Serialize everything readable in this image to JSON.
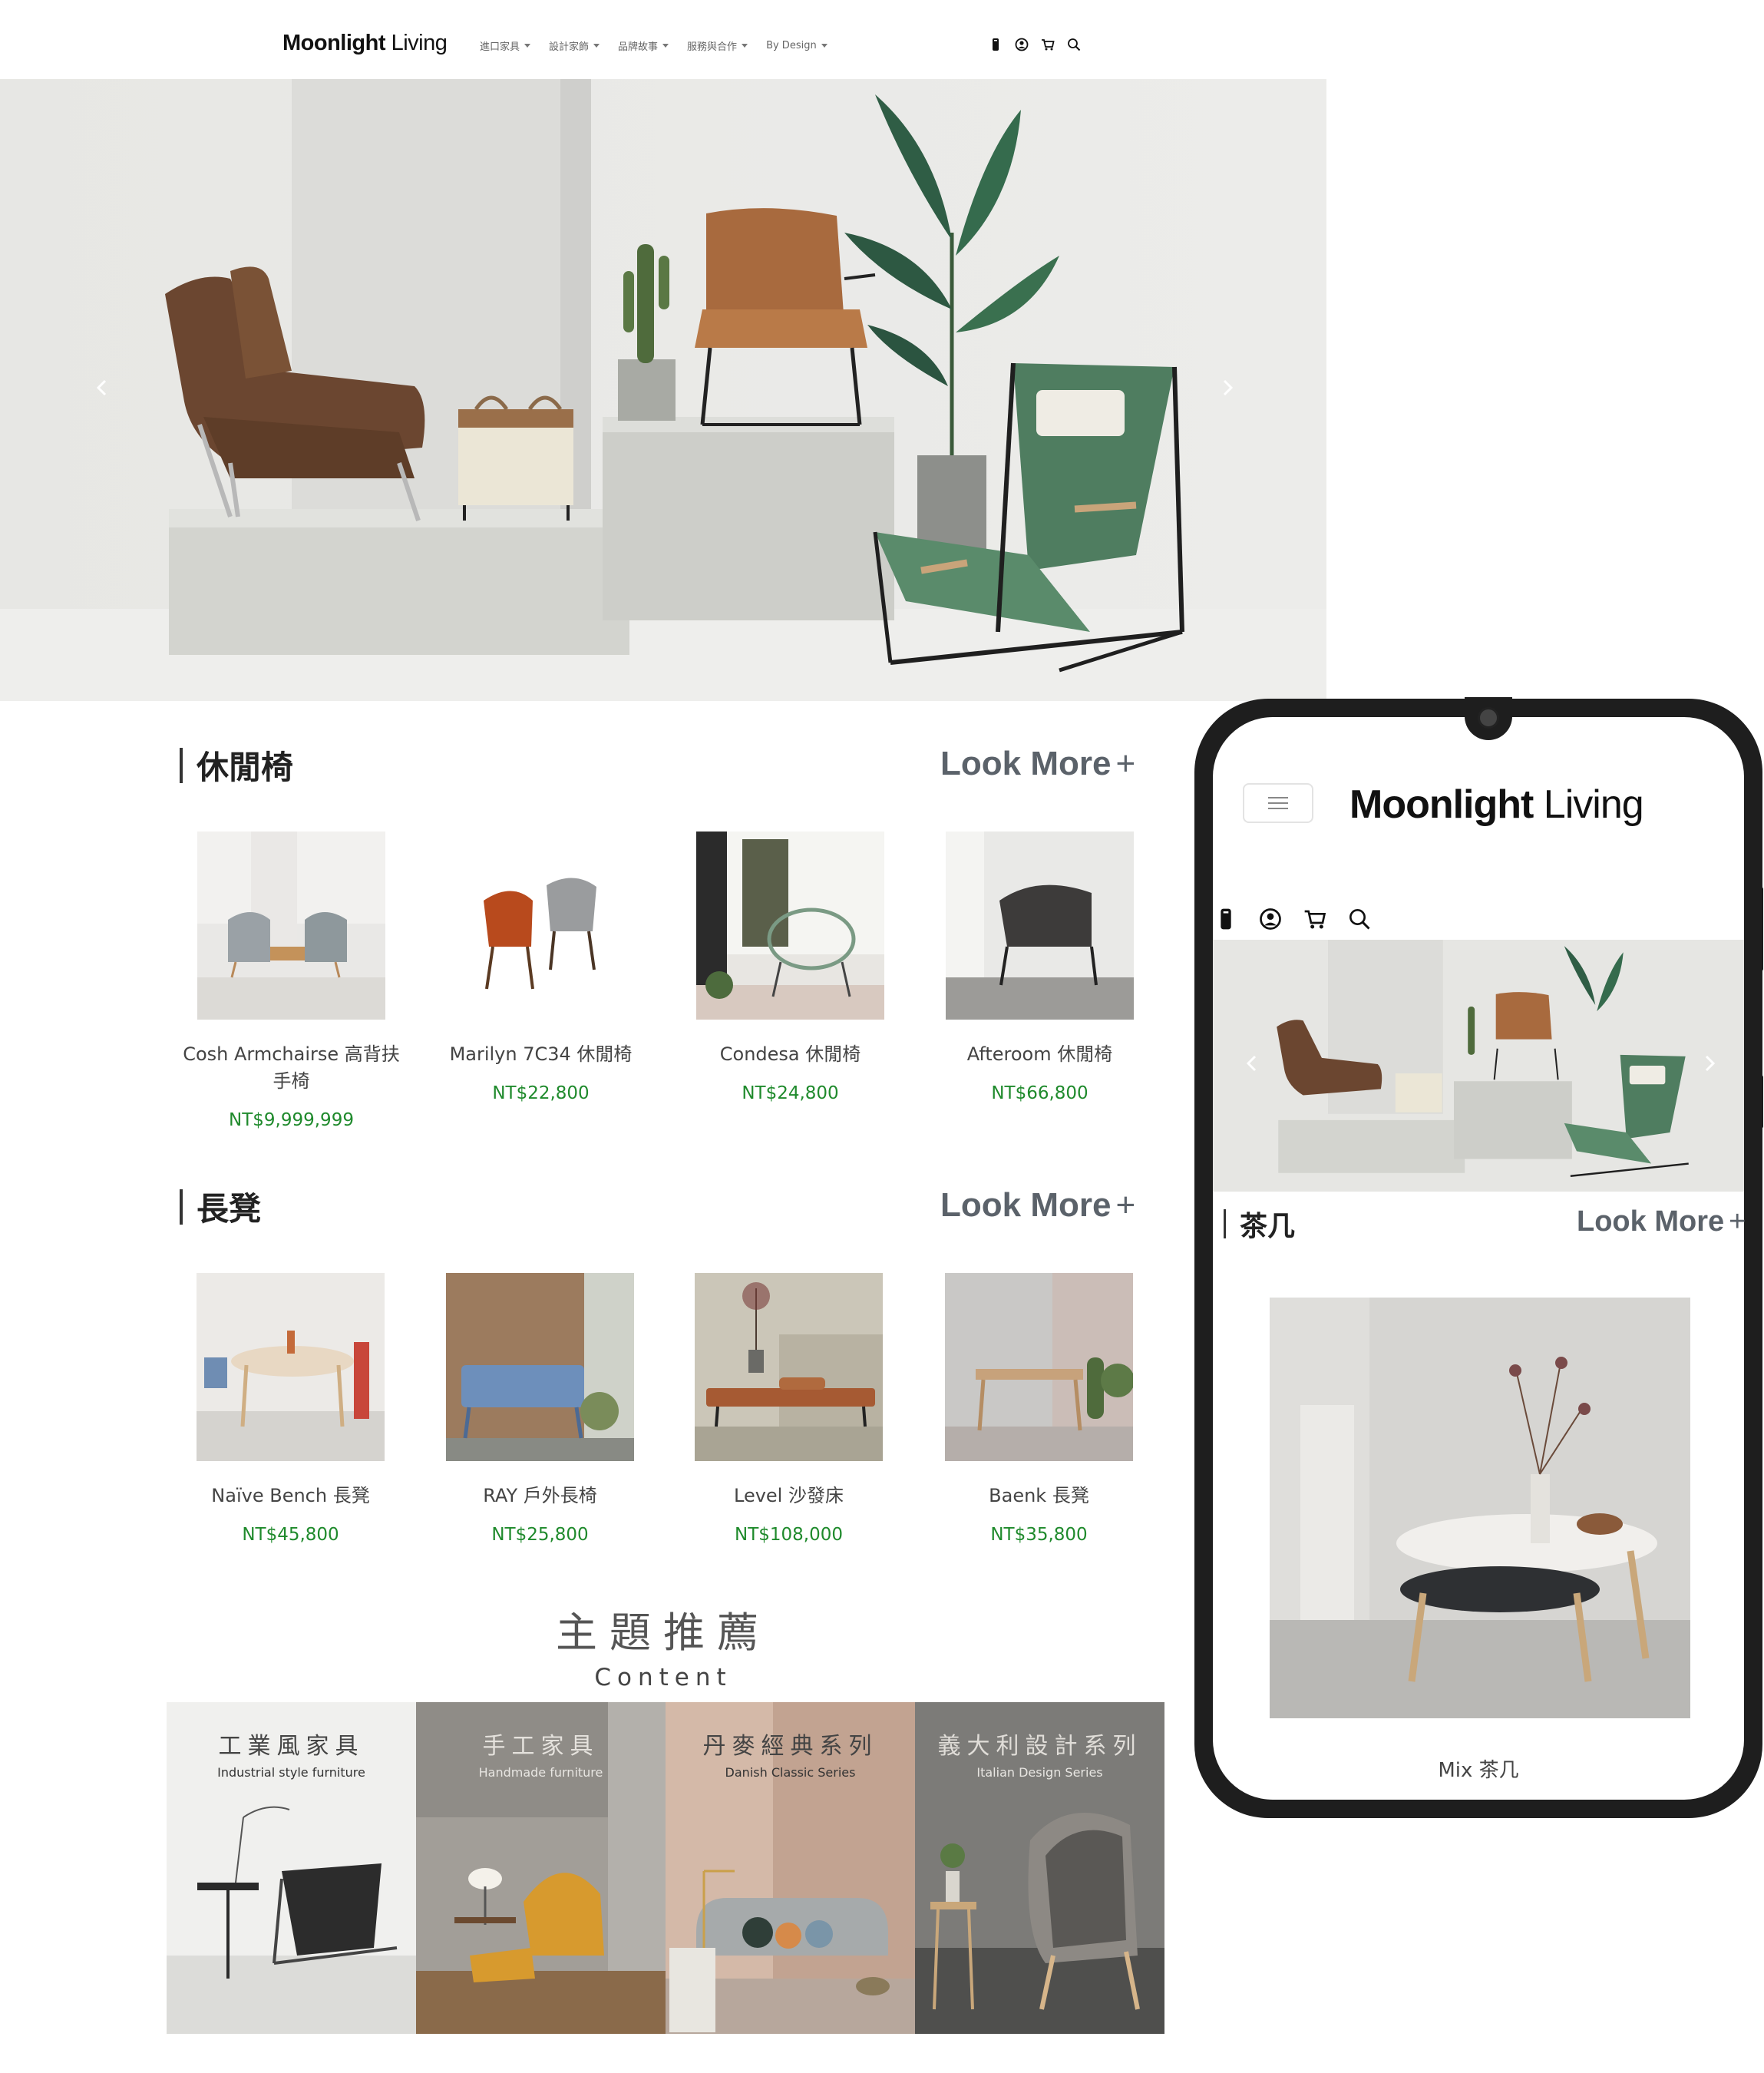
{
  "desktop": {
    "logo": {
      "bold": "Moonlight",
      "light": " Living"
    },
    "nav": [
      "進口家具",
      "設計家飾",
      "品牌故事",
      "服務與合作",
      "By Design"
    ],
    "icons": [
      "phone-icon",
      "user-icon",
      "cart-icon",
      "search-icon"
    ],
    "sections": [
      {
        "title": "休閒椅",
        "more": "Look More",
        "more_plus": "+",
        "products": [
          {
            "name": "Cosh Armchairse 高背扶手椅",
            "price": "NT$9,999,999"
          },
          {
            "name": "Marilyn 7C34 休閒椅",
            "price": "NT$22,800"
          },
          {
            "name": "Condesa 休閒椅",
            "price": "NT$24,800"
          },
          {
            "name": "Afteroom 休閒椅",
            "price": "NT$66,800"
          }
        ]
      },
      {
        "title": "長凳",
        "more": "Look More",
        "more_plus": "+",
        "products": [
          {
            "name": "Naïve Bench 長凳",
            "price": "NT$45,800"
          },
          {
            "name": "RAY 戶外長椅",
            "price": "NT$25,800"
          },
          {
            "name": "Level 沙發床",
            "price": "NT$108,000"
          },
          {
            "name": "Baenk 長凳",
            "price": "NT$35,800"
          }
        ]
      }
    ],
    "content": {
      "title_zh": "主題推薦",
      "title_en": "Content",
      "banners": [
        {
          "zh": "工業風家具",
          "en": "Industrial style furniture"
        },
        {
          "zh": "手工家具",
          "en": "Handmade furniture"
        },
        {
          "zh": "丹麥經典系列",
          "en": "Danish Classic Series"
        },
        {
          "zh": "義大利設計系列",
          "en": "Italian Design Series"
        }
      ]
    }
  },
  "mobile": {
    "logo": {
      "bold": "Moonlight",
      "light": " Living"
    },
    "section_title": "茶几",
    "more": "Look More",
    "more_plus": "+",
    "product_name": "Mix 茶几"
  },
  "colors": {
    "price": "#1f8a2c",
    "look_more": "#5b626a",
    "phone_frame": "#1e1e1e"
  }
}
